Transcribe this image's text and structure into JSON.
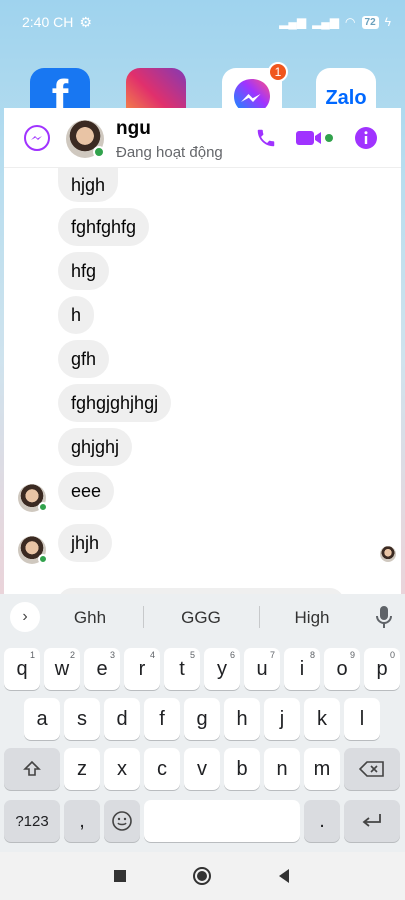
{
  "status_bar": {
    "time": "2:40 CH",
    "battery": "72"
  },
  "home": {
    "apps": [
      "Facebook",
      "Instagram",
      "Messenger",
      "Zalo"
    ],
    "zalo_label": "Zalo",
    "messenger_badge": "1"
  },
  "chat": {
    "contact_name": "ngu",
    "contact_status": "Đang hoạt động",
    "messages": [
      "hjgh",
      "fghfghfg",
      "hfg",
      "h",
      "gfh",
      "fghgjghjhgj",
      "ghjghj",
      "eee",
      "jhjh"
    ]
  },
  "keyboard": {
    "suggestions": [
      "Ghh",
      "GGG",
      "High"
    ],
    "row1": [
      "q",
      "w",
      "e",
      "r",
      "t",
      "y",
      "u",
      "i",
      "o",
      "p"
    ],
    "row1_hints": [
      "1",
      "2",
      "3",
      "4",
      "5",
      "6",
      "7",
      "8",
      "9",
      "0"
    ],
    "row2": [
      "a",
      "s",
      "d",
      "f",
      "g",
      "h",
      "j",
      "k",
      "l"
    ],
    "row3": [
      "z",
      "x",
      "c",
      "v",
      "b",
      "n",
      "m"
    ],
    "symbols_label": "?123",
    "comma": ",",
    "period": "."
  },
  "colors": {
    "messenger_purple": "#a033ff",
    "online_green": "#31a24c"
  }
}
